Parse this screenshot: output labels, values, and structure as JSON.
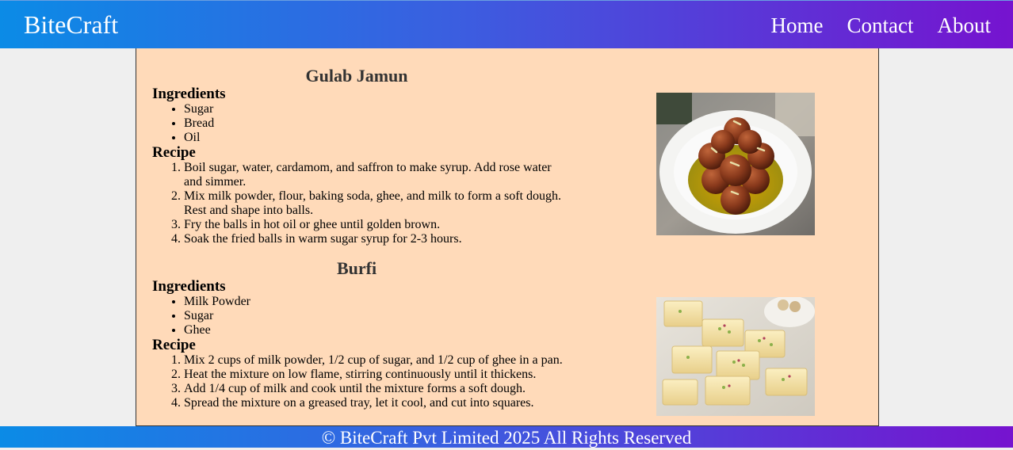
{
  "nav": {
    "brand": "BiteCraft",
    "links": [
      "Home",
      "Contact",
      "About"
    ]
  },
  "recipes": [
    {
      "title": "Gulab Jamun",
      "ingredients_heading": "Ingredients",
      "ingredients": [
        "Sugar",
        "Bread",
        "Oil"
      ],
      "recipe_heading": "Recipe",
      "steps": [
        "Boil sugar, water, cardamom, and saffron to make syrup. Add rose water and simmer.",
        "Mix milk powder, flour, baking soda, ghee, and milk to form a soft dough. Rest and shape into balls.",
        "Fry the balls in hot oil or ghee until golden brown.",
        "Soak the fried balls in warm sugar syrup for 2-3 hours."
      ]
    },
    {
      "title": "Burfi",
      "ingredients_heading": "Ingredients",
      "ingredients": [
        "Milk Powder",
        "Sugar",
        "Ghee"
      ],
      "recipe_heading": "Recipe",
      "steps": [
        "Mix 2 cups of milk powder, 1/2 cup of sugar, and 1/2 cup of ghee in a pan.",
        "Heat the mixture on low flame, stirring continuously until it thickens.",
        "Add 1/4 cup of milk and cook until the mixture forms a soft dough.",
        "Spread the mixture on a greased tray, let it cool, and cut into squares."
      ]
    }
  ],
  "footer": {
    "text": "© BiteCraft Pvt Limited 2025 All Rights Reserved"
  },
  "colors": {
    "nav_gradient_start": "#0b8be6",
    "nav_gradient_end": "#7613cf",
    "content_background": "#ffdab9",
    "page_background": "#efefef"
  }
}
